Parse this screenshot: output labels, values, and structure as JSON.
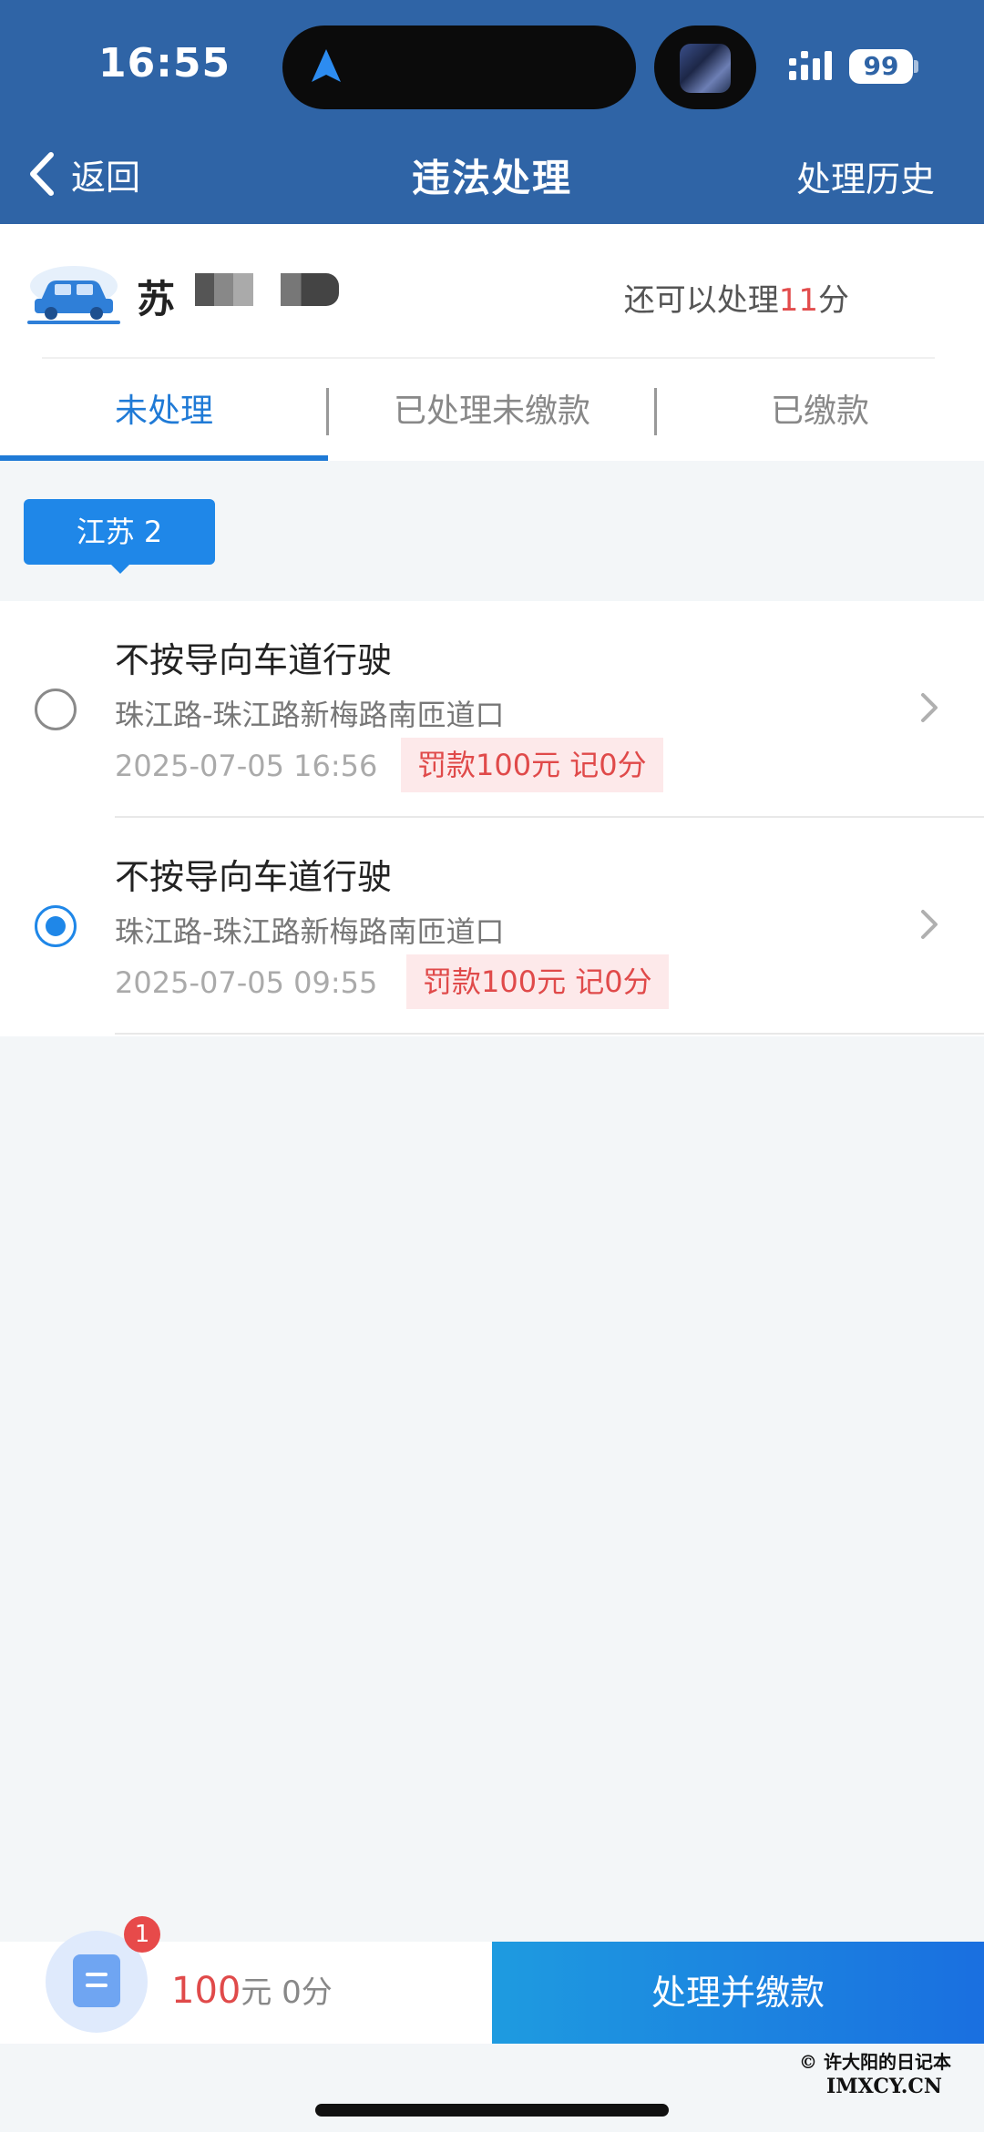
{
  "status_bar": {
    "time": "16:55",
    "battery": "99"
  },
  "nav": {
    "back_label": "返回",
    "title": "违法处理",
    "history_label": "处理历史"
  },
  "vehicle": {
    "plate_province": "苏",
    "points_prefix": "还可以处理",
    "points_value": "11",
    "points_suffix": "分"
  },
  "tabs": [
    {
      "label": "未处理",
      "active": true
    },
    {
      "label": "已处理未缴款",
      "active": false
    },
    {
      "label": "已缴款",
      "active": false
    }
  ],
  "region_tag": "江苏 2",
  "violations": [
    {
      "title": "不按导向车道行驶",
      "location": "珠江路-珠江路新梅路南匝道口",
      "time": "2025-07-05 16:56",
      "fine": "罚款100元  记0分",
      "selected": false
    },
    {
      "title": "不按导向车道行驶",
      "location": "珠江路-珠江路新梅路南匝道口",
      "time": "2025-07-05 09:55",
      "fine": "罚款100元  记0分",
      "selected": true
    }
  ],
  "bottom": {
    "badge_count": "1",
    "amount": "100",
    "amount_unit": "元",
    "points": "0分",
    "pay_label": "处理并缴款"
  },
  "watermark": {
    "line1": "© 许大阳的日记本",
    "line2": "IMXCY.CN"
  },
  "colors": {
    "header": "#2f64a6",
    "accent": "#1f7ad6",
    "fine_red": "#e04a4a"
  }
}
